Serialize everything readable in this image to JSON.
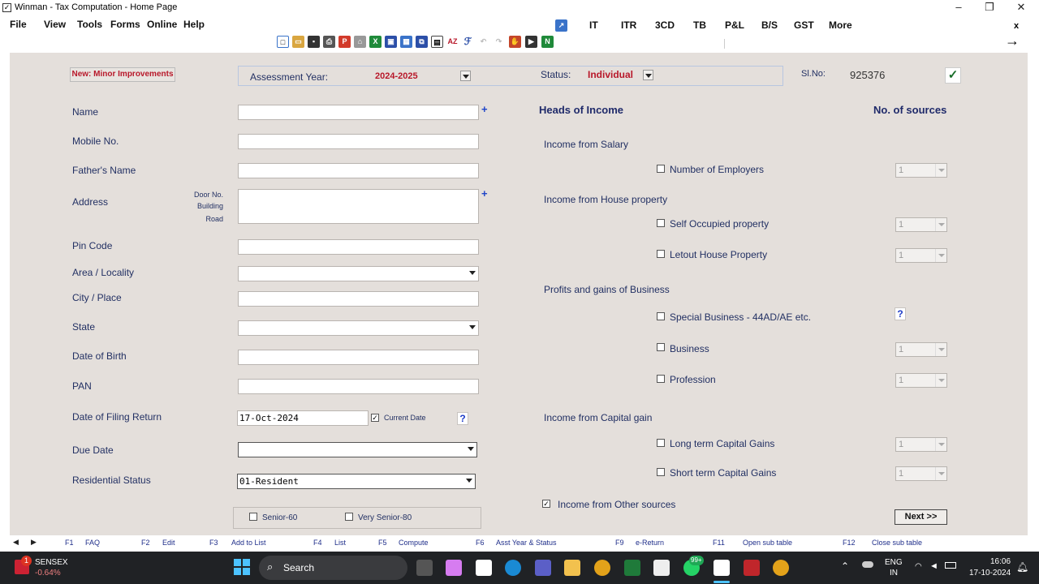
{
  "window": {
    "title": "Winman - Tax Computation - Home Page",
    "close_tab_label": "x"
  },
  "menu": {
    "file": "File",
    "view": "View",
    "tools": "Tools",
    "forms": "Forms",
    "online": "Online",
    "help": "Help"
  },
  "quick_menu": [
    "IT",
    "ITR",
    "3CD",
    "TB",
    "P&L",
    "B/S",
    "GST",
    "More"
  ],
  "header": {
    "new_badge": "New: Minor Improvements",
    "assessment_year_label": "Assessment Year:",
    "assessment_year_value": "2024-2025",
    "status_label": "Status:",
    "status_value": "Individual",
    "slno_label": "Sl.No:",
    "slno_value": "925376",
    "check_mark": "✓"
  },
  "form": {
    "name_label": "Name",
    "mobile_label": "Mobile No.",
    "father_label": "Father's Name",
    "address_label": "Address",
    "door_label": "Door No.",
    "building_label": "Building",
    "road_label": "Road",
    "pin_label": "Pin Code",
    "area_label": "Area / Locality",
    "city_label": "City / Place",
    "state_label": "State",
    "dob_label": "Date of Birth",
    "pan_label": "PAN",
    "filing_label": "Date of Filing Return",
    "filing_value": "17-Oct-2024",
    "current_date_label": "Current Date",
    "due_label": "Due Date",
    "residential_label": "Residential Status",
    "residential_value": "01-Resident",
    "senior60_label": "Senior-60",
    "vsenior80_label": "Very Senior-80",
    "plus": "+",
    "question": "?"
  },
  "income": {
    "heads_title": "Heads of Income",
    "sources_title": "No. of sources",
    "salary_head": "Income from Salary",
    "employers": "Number of Employers",
    "house_head": "Income from House property",
    "self_occupied": "Self Occupied property",
    "letout": "Letout House Property",
    "business_head": "Profits and gains of Business",
    "special_business": "Special Business - 44AD/AE etc.",
    "business": "Business",
    "profession": "Profession",
    "capital_head": "Income from Capital gain",
    "ltcg": "Long term Capital Gains",
    "stcg": "Short term Capital Gains",
    "other_sources": "Income from Other sources",
    "default_count": "1",
    "next_button": "Next >>",
    "question": "?"
  },
  "fkeys": [
    {
      "key": "F1",
      "label": "FAQ"
    },
    {
      "key": "F2",
      "label": "Edit"
    },
    {
      "key": "F3",
      "label": "Add to List"
    },
    {
      "key": "F4",
      "label": "List"
    },
    {
      "key": "F5",
      "label": "Compute"
    },
    {
      "key": "F6",
      "label": "Asst Year & Status"
    },
    {
      "key": "F9",
      "label": "e-Return"
    },
    {
      "key": "F11",
      "label": "Open sub table"
    },
    {
      "key": "F12",
      "label": "Close sub table"
    }
  ],
  "taskbar": {
    "sensex_label": "SENSEX",
    "sensex_value": "-0.64%",
    "notif_count": "1",
    "search_label": "Search",
    "whatsapp_badge": "99+",
    "lang1": "ENG",
    "lang2": "IN",
    "time": "16:06",
    "date": "17-10-2024"
  },
  "colors": {
    "panel": "#e4dfdb",
    "accent_red": "#b8182a",
    "label_blue": "#223063",
    "link_blue": "#1f2e8a"
  }
}
